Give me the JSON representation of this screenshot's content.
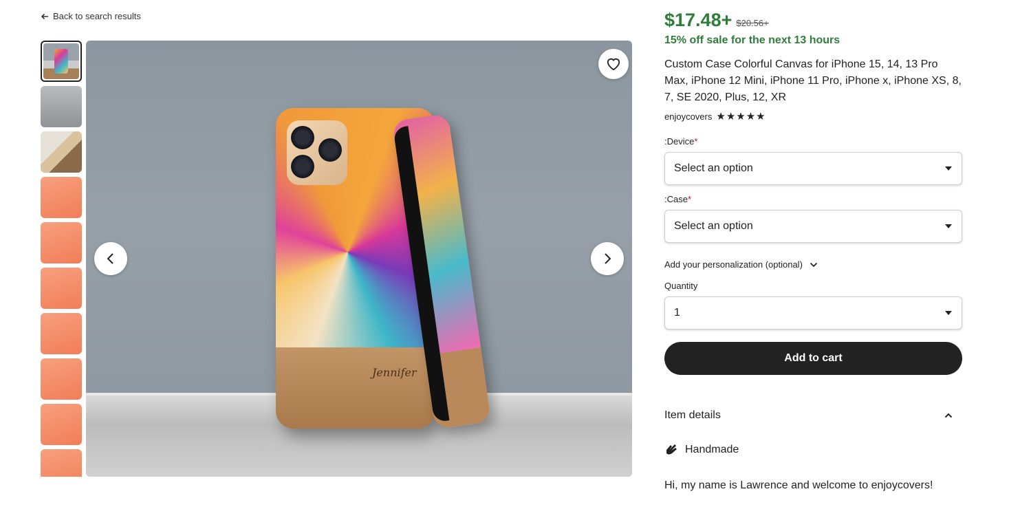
{
  "nav": {
    "back_label": "Back to search results"
  },
  "gallery": {
    "thumbnails": [
      "main-photo",
      "video",
      "hand-photo",
      "orange-1",
      "orange-2",
      "orange-3",
      "orange-4",
      "orange-5",
      "orange-6",
      "orange-7"
    ],
    "main_image": {
      "engraved_name": "Jennifer"
    },
    "favorite_icon": "heart-icon",
    "prev_icon": "chevron-left-icon",
    "next_icon": "chevron-right-icon",
    "play_icon": "play-icon"
  },
  "product": {
    "price": "$17.48+",
    "original_price": "$20.56+",
    "sale_text": "15% off sale for the next 13 hours",
    "title": "Custom Case Colorful Canvas for iPhone 15, 14, 13 Pro Max, iPhone 12 Mini, iPhone 11 Pro, iPhone x, iPhone XS, 8, 7, SE 2020, Plus, 12, XR",
    "seller": "enjoycovers",
    "stars": "★★★★★",
    "rating": 5
  },
  "options": {
    "device": {
      "label": ":Device",
      "required_mark": "*",
      "value": "Select an option"
    },
    "case": {
      "label": ":Case",
      "required_mark": "*",
      "value": "Select an option"
    },
    "personalization_label": "Add your personalization (optional)",
    "quantity": {
      "label": "Quantity",
      "value": "1"
    }
  },
  "cart": {
    "add_label": "Add to cart"
  },
  "details": {
    "heading": "Item details",
    "handmade_label": "Handmade",
    "description": "Hi, my name is Lawrence and welcome to enjoycovers!"
  },
  "colors": {
    "price_green": "#2f7d3a",
    "button_dark": "#222222",
    "required_red": "#a61a2e"
  }
}
